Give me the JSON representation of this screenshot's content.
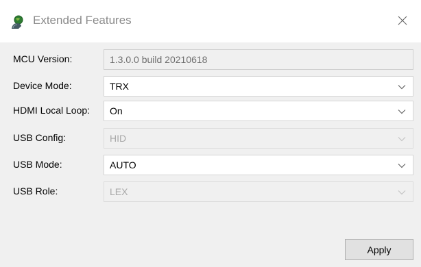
{
  "window": {
    "title": "Extended Features",
    "app_icon": "user-globe-icon",
    "close_icon": "close-icon"
  },
  "rows": [
    {
      "label": "MCU Version:",
      "value": "1.3.0.0 build 20210618",
      "kind": "readonly-text"
    },
    {
      "label": "Device Mode:",
      "value": "TRX",
      "kind": "dropdown",
      "enabled": true
    },
    {
      "label": "HDMI Local Loop:",
      "value": "On",
      "kind": "dropdown",
      "enabled": true
    },
    {
      "label": "USB Config:",
      "value": "HID",
      "kind": "dropdown",
      "enabled": false
    },
    {
      "label": "USB Mode:",
      "value": "AUTO",
      "kind": "dropdown",
      "enabled": true
    },
    {
      "label": "USB Role:",
      "value": "LEX",
      "kind": "dropdown",
      "enabled": false
    }
  ],
  "buttons": {
    "apply_label": "Apply"
  },
  "colors": {
    "title_text": "#8a8a8a",
    "window_bg": "#f0f0f0",
    "titlebar_bg": "#ffffff",
    "disabled_text": "#a8a8a8",
    "chevron": "#666666",
    "chevron_disabled": "#c4c4c4"
  }
}
